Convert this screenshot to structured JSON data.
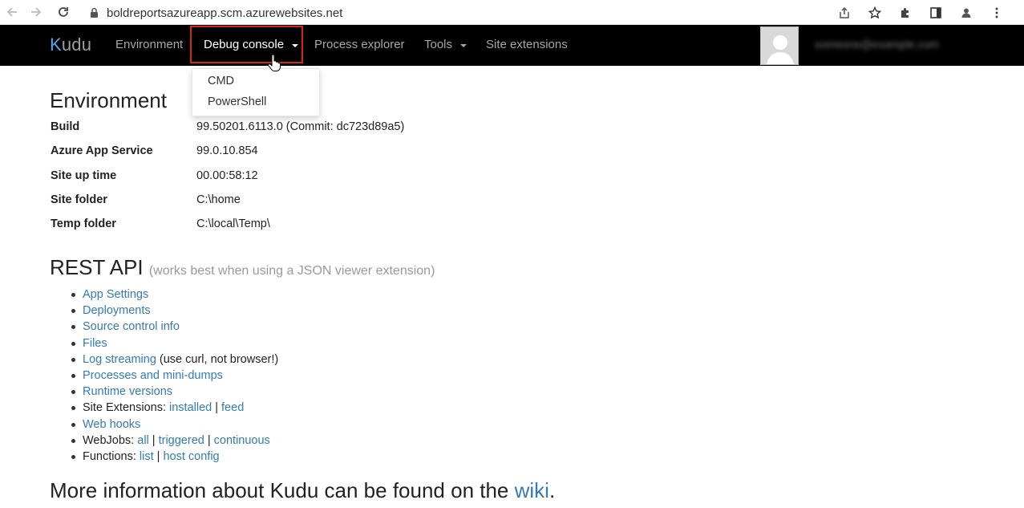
{
  "browser": {
    "url": "boldreportsazureapp.scm.azurewebsites.net"
  },
  "navbar": {
    "brand": "Kudu",
    "brand_first": "K",
    "brand_rest": "udu",
    "items": {
      "environment": "Environment",
      "debug_console": "Debug console",
      "process_explorer": "Process explorer",
      "tools": "Tools",
      "site_extensions": "Site extensions"
    },
    "user_email": "someone@example.com"
  },
  "dropdown": {
    "items": [
      "CMD",
      "PowerShell"
    ]
  },
  "environment": {
    "title": "Environment",
    "rows": [
      {
        "key": "Build",
        "value": "99.50201.6113.0 (Commit: dc723d89a5)"
      },
      {
        "key": "Azure App Service",
        "value": "99.0.10.854"
      },
      {
        "key": "Site up time",
        "value": "00.00:58:12"
      },
      {
        "key": "Site folder",
        "value": "C:\\home"
      },
      {
        "key": "Temp folder",
        "value": "C:\\local\\Temp\\"
      }
    ]
  },
  "rest_api": {
    "title": "REST API",
    "subtitle": "(works best when using a JSON viewer extension)",
    "app_settings": "App Settings",
    "deployments": "Deployments",
    "source_control_info": "Source control info",
    "files": "Files",
    "log_streaming": "Log streaming",
    "log_streaming_note": " (use curl, not browser!)",
    "processes": "Processes and mini-dumps",
    "runtime_versions": "Runtime versions",
    "site_extensions_label": "Site Extensions: ",
    "installed": "installed",
    "feed": "feed",
    "web_hooks": "Web hooks",
    "webjobs_label": "WebJobs: ",
    "all": "all",
    "triggered": "triggered",
    "continuous": "continuous",
    "functions_label": "Functions: ",
    "list": "list",
    "host_config": "host config",
    "separator": " | "
  },
  "footer": {
    "text_before": "More information about Kudu can be found on the ",
    "wiki": "wiki",
    "text_after": "."
  },
  "colors": {
    "navbar_bg": "#000000",
    "link": "#337ab7",
    "highlight_border": "#d7261f"
  }
}
